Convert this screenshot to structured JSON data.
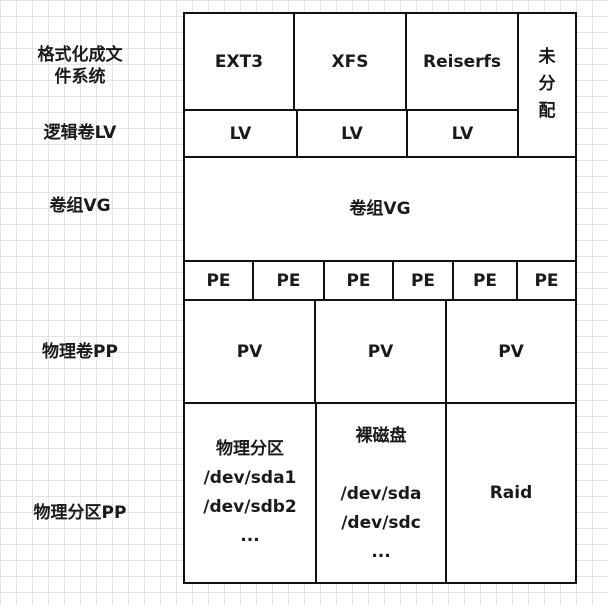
{
  "left_labels": {
    "format_line1": "格式化成文",
    "format_line2": "件系统",
    "lv": "逻辑卷LV",
    "vg": "卷组VG",
    "pv": "物理卷PP",
    "partition": "物理分区PP"
  },
  "filesystems": {
    "ext3": "EXT3",
    "xfs": "XFS",
    "reiserfs": "Reiserfs",
    "unallocated": [
      "未",
      "分",
      "配"
    ]
  },
  "logical_volumes": [
    "LV",
    "LV",
    "LV"
  ],
  "volume_group": "卷组VG",
  "physical_extents": [
    "PE",
    "PE",
    "PE",
    "PE",
    "PE",
    "PE"
  ],
  "physical_volumes": [
    "PV",
    "PV",
    "PV"
  ],
  "partitions": {
    "physical": {
      "title": "物理分区",
      "line1": "/dev/sda1",
      "line2": "/dev/sdb2",
      "more": "..."
    },
    "raw_disk": {
      "title": "裸磁盘",
      "line1": "/dev/sda",
      "line2": "/dev/sdc",
      "more": "..."
    },
    "raid": "Raid"
  }
}
